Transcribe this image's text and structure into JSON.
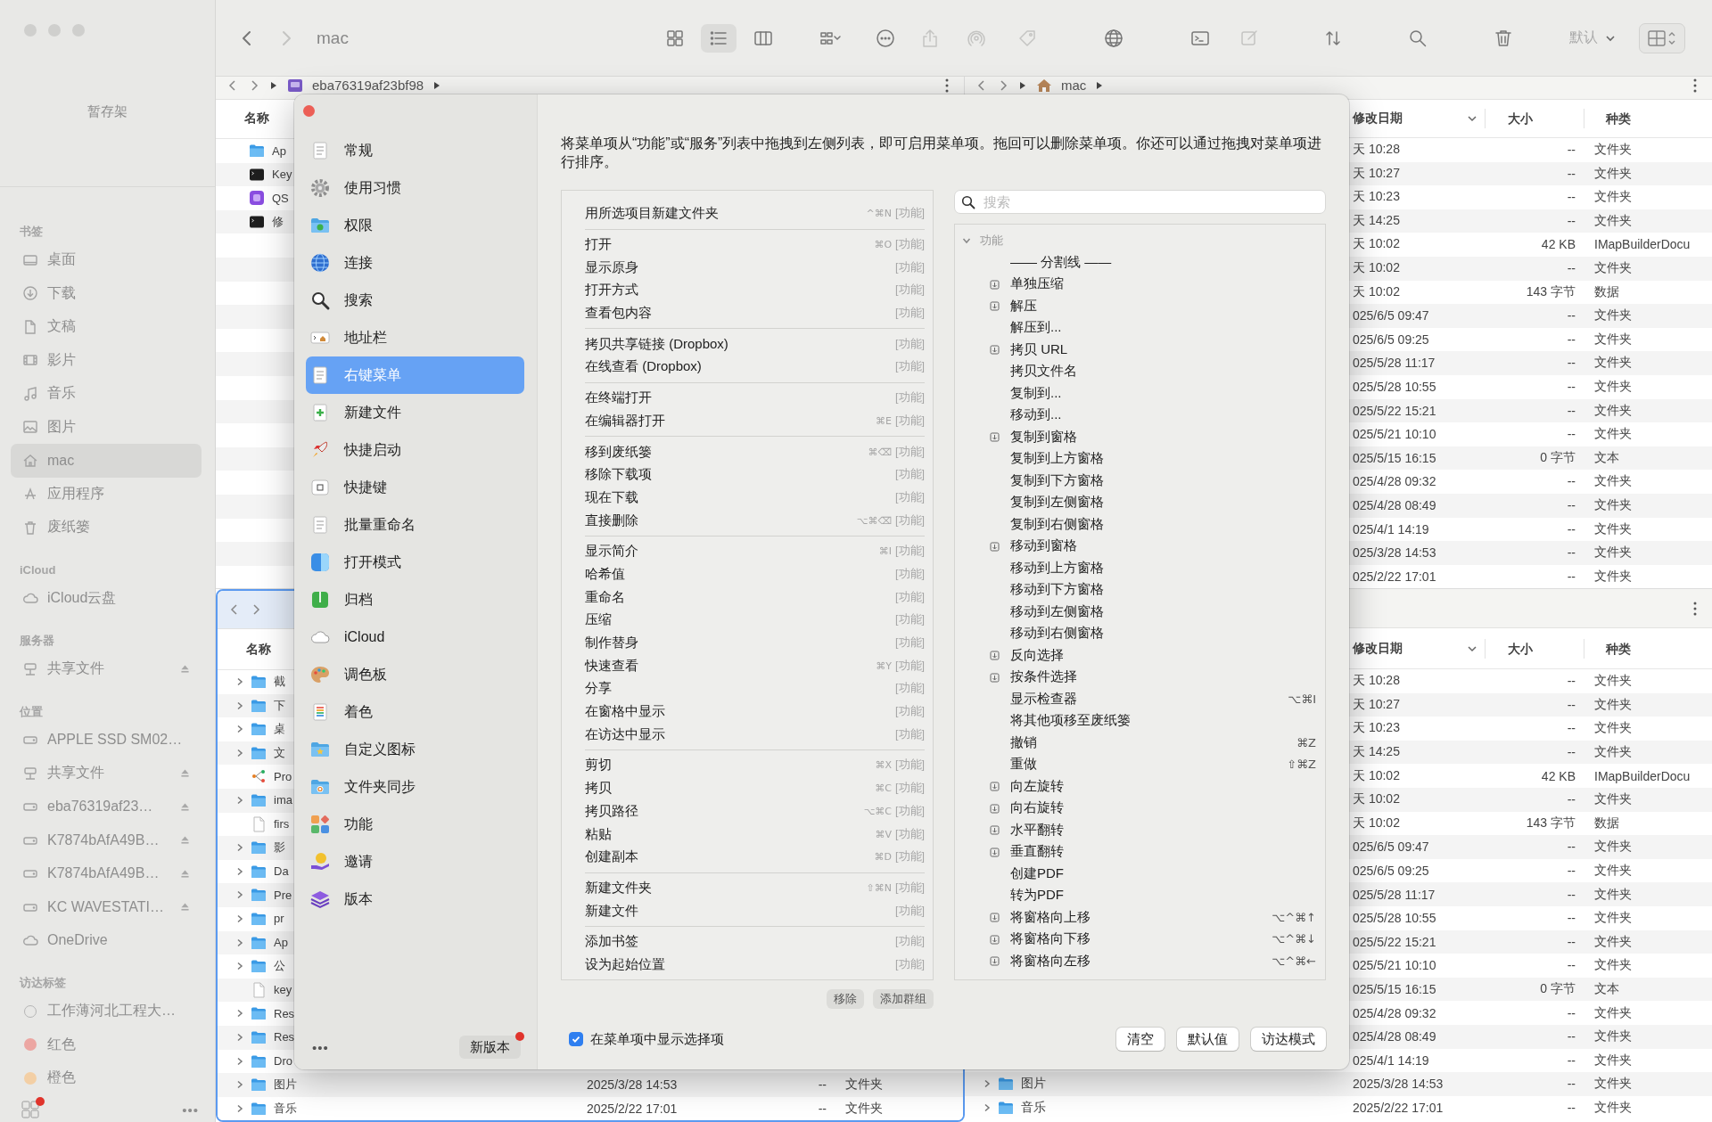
{
  "sidebar": {
    "shelf": "暂存架",
    "sections": [
      {
        "title": "书签",
        "items": [
          {
            "label": "桌面",
            "kind": "desktop",
            "selected": false,
            "ejectable": false
          },
          {
            "label": "下载",
            "kind": "download",
            "selected": false,
            "ejectable": false
          },
          {
            "label": "文稿",
            "kind": "document",
            "selected": false,
            "ejectable": false
          },
          {
            "label": "影片",
            "kind": "movie",
            "selected": false,
            "ejectable": false
          },
          {
            "label": "音乐",
            "kind": "music",
            "selected": false,
            "ejectable": false
          },
          {
            "label": "图片",
            "kind": "picture",
            "selected": false,
            "ejectable": false
          },
          {
            "label": "mac",
            "kind": "home",
            "selected": true,
            "ejectable": false
          },
          {
            "label": "应用程序",
            "kind": "apps",
            "selected": false,
            "ejectable": false
          },
          {
            "label": "废纸篓",
            "kind": "trash",
            "selected": false,
            "ejectable": false
          }
        ]
      },
      {
        "title": "iCloud",
        "items": [
          {
            "label": "iCloud云盘",
            "kind": "cloud",
            "selected": false,
            "ejectable": false
          }
        ]
      },
      {
        "title": "服务器",
        "items": [
          {
            "label": "共享文件",
            "kind": "server",
            "selected": false,
            "ejectable": true
          }
        ]
      },
      {
        "title": "位置",
        "items": [
          {
            "label": "APPLE SSD SM02…",
            "kind": "disk",
            "selected": false,
            "ejectable": false
          },
          {
            "label": "共享文件",
            "kind": "server",
            "selected": false,
            "ejectable": true
          },
          {
            "label": "eba76319af23…",
            "kind": "disk",
            "selected": false,
            "ejectable": true
          },
          {
            "label": "K7874bAfA49B…",
            "kind": "disk",
            "selected": false,
            "ejectable": true
          },
          {
            "label": "K7874bAfA49B…",
            "kind": "disk",
            "selected": false,
            "ejectable": true
          },
          {
            "label": "KC WAVESTATI…",
            "kind": "disk",
            "selected": false,
            "ejectable": true
          },
          {
            "label": "OneDrive",
            "kind": "cloud",
            "selected": false,
            "ejectable": false
          }
        ]
      },
      {
        "title": "访达标签",
        "items": [
          {
            "label": "工作薄河北工程大…",
            "kind": "tag",
            "selected": false,
            "ejectable": false
          },
          {
            "label": "红色",
            "kind": "tag",
            "color": "#eca6a2",
            "selected": false,
            "ejectable": false
          },
          {
            "label": "橙色",
            "kind": "tag",
            "color": "#f3cfa5",
            "selected": false,
            "ejectable": false
          }
        ]
      }
    ],
    "footer": {
      "badge": true,
      "more": "•••"
    }
  },
  "toolbar": {
    "nav": [
      {
        "kind": "back",
        "disabled": false
      },
      {
        "kind": "forward",
        "disabled": true
      }
    ],
    "title": "mac",
    "tools": [
      {
        "kind": "icons",
        "selected": false,
        "disabled": false
      },
      {
        "kind": "list",
        "selected": true,
        "disabled": false
      },
      {
        "kind": "columns",
        "selected": false,
        "disabled": false
      },
      {
        "kind": "group",
        "selected": false,
        "disabled": false
      },
      {
        "kind": "more",
        "selected": false,
        "disabled": false
      },
      {
        "kind": "share",
        "selected": false,
        "disabled": true
      },
      {
        "kind": "airdrop",
        "selected": false,
        "disabled": true
      },
      {
        "kind": "tag",
        "selected": false,
        "disabled": true
      },
      {
        "kind": "globe",
        "selected": false,
        "disabled": false
      },
      {
        "kind": "terminal",
        "selected": false,
        "disabled": false
      },
      {
        "kind": "edit",
        "selected": false,
        "disabled": true
      },
      {
        "kind": "sort",
        "selected": false,
        "disabled": false
      },
      {
        "kind": "search",
        "selected": false,
        "disabled": false
      },
      {
        "kind": "trash",
        "selected": false,
        "disabled": false
      }
    ],
    "sort_menu": "默认"
  },
  "panes": [
    {
      "focused": false,
      "nav": true,
      "menu": true,
      "path": {
        "kind": "disk",
        "label": "eba76319af23bf98"
      },
      "header": {
        "name": "名称"
      },
      "rows": [
        {
          "name": "Ap",
          "kind": "folder",
          "expandable": false
        },
        {
          "name": "Key",
          "kind": "terminal",
          "expandable": false
        },
        {
          "name": "QS",
          "kind": "app",
          "expandable": false
        },
        {
          "name": "修",
          "kind": "terminal",
          "expandable": false
        }
      ]
    },
    {
      "focused": false,
      "nav": true,
      "menu": true,
      "path": {
        "kind": "home",
        "label": "mac"
      },
      "header": {
        "date": "修改日期",
        "size": "大小",
        "type": "种类"
      },
      "rows": [
        {
          "date": "天 10:28",
          "size": "--",
          "type": "文件夹"
        },
        {
          "date": "天 10:27",
          "size": "--",
          "type": "文件夹"
        },
        {
          "date": "天 10:23",
          "size": "--",
          "type": "文件夹"
        },
        {
          "date": "天 14:25",
          "size": "--",
          "type": "文件夹"
        },
        {
          "date": "天 10:02",
          "size": "42 KB",
          "type": "IMapBuilderDocu"
        },
        {
          "date": "天 10:02",
          "size": "--",
          "type": "文件夹"
        },
        {
          "date": "天 10:02",
          "size": "143 字节",
          "type": "数据"
        },
        {
          "date": "025/6/5 09:47",
          "size": "--",
          "type": "文件夹"
        },
        {
          "date": "025/6/5 09:25",
          "size": "--",
          "type": "文件夹"
        },
        {
          "date": "025/5/28 11:17",
          "size": "--",
          "type": "文件夹"
        },
        {
          "date": "025/5/28 10:55",
          "size": "--",
          "type": "文件夹"
        },
        {
          "date": "025/5/22 15:21",
          "size": "--",
          "type": "文件夹"
        },
        {
          "date": "025/5/21 10:10",
          "size": "--",
          "type": "文件夹"
        },
        {
          "date": "025/5/15 16:15",
          "size": "0 字节",
          "type": "文本"
        },
        {
          "date": "025/4/28 09:32",
          "size": "--",
          "type": "文件夹"
        },
        {
          "date": "025/4/28 08:49",
          "size": "--",
          "type": "文件夹"
        },
        {
          "date": "025/4/1 14:19",
          "size": "--",
          "type": "文件夹"
        },
        {
          "date": "025/3/28 14:53",
          "size": "--",
          "type": "文件夹"
        },
        {
          "date": "025/2/22 17:01",
          "size": "--",
          "type": "文件夹"
        }
      ]
    },
    {
      "focused": true,
      "nav": true,
      "menu": false,
      "header": {
        "name": "名称"
      },
      "rows": [
        {
          "name": "截",
          "kind": "folder",
          "expandable": true
        },
        {
          "name": "下",
          "kind": "folder",
          "expandable": true
        },
        {
          "name": "桌",
          "kind": "folder",
          "expandable": true
        },
        {
          "name": "文",
          "kind": "folder",
          "expandable": true
        },
        {
          "name": "Pro",
          "kind": "diagram",
          "expandable": false
        },
        {
          "name": "ima",
          "kind": "folder",
          "expandable": true
        },
        {
          "name": "firs",
          "kind": "file",
          "expandable": false
        },
        {
          "name": "影",
          "kind": "folder",
          "expandable": true
        },
        {
          "name": "Da",
          "kind": "folder",
          "expandable": true
        },
        {
          "name": "Pre",
          "kind": "folder",
          "expandable": true
        },
        {
          "name": "pr",
          "kind": "folder",
          "expandable": true
        },
        {
          "name": "Ap",
          "kind": "folder",
          "expandable": true
        },
        {
          "name": "公",
          "kind": "folder",
          "expandable": true
        },
        {
          "name": "key",
          "kind": "file",
          "expandable": false
        },
        {
          "name": "Res",
          "kind": "folder",
          "expandable": true
        },
        {
          "name": "Res",
          "kind": "folder",
          "expandable": true
        },
        {
          "name": "Dro",
          "kind": "folder",
          "expandable": true
        },
        {
          "name": "图片",
          "kind": "folder",
          "expandable": true,
          "date": "2025/3/28 14:53",
          "size": "--",
          "type": "文件夹"
        },
        {
          "name": "音乐",
          "kind": "folder",
          "expandable": true,
          "date": "2025/2/22 17:01",
          "size": "--",
          "type": "文件夹"
        }
      ]
    },
    {
      "focused": false,
      "nav": false,
      "menu": true,
      "header": {
        "date": "修改日期",
        "size": "大小",
        "type": "种类"
      },
      "rows": [
        {
          "date": "天 10:28",
          "size": "--",
          "type": "文件夹"
        },
        {
          "date": "天 10:27",
          "size": "--",
          "type": "文件夹"
        },
        {
          "date": "天 10:23",
          "size": "--",
          "type": "文件夹"
        },
        {
          "date": "天 14:25",
          "size": "--",
          "type": "文件夹"
        },
        {
          "date": "天 10:02",
          "size": "42 KB",
          "type": "IMapBuilderDocu"
        },
        {
          "date": "天 10:02",
          "size": "--",
          "type": "文件夹"
        },
        {
          "date": "天 10:02",
          "size": "143 字节",
          "type": "数据"
        },
        {
          "date": "025/6/5 09:47",
          "size": "--",
          "type": "文件夹"
        },
        {
          "date": "025/6/5 09:25",
          "size": "--",
          "type": "文件夹"
        },
        {
          "date": "025/5/28 11:17",
          "size": "--",
          "type": "文件夹"
        },
        {
          "date": "025/5/28 10:55",
          "size": "--",
          "type": "文件夹"
        },
        {
          "date": "025/5/22 15:21",
          "size": "--",
          "type": "文件夹"
        },
        {
          "date": "025/5/21 10:10",
          "size": "--",
          "type": "文件夹"
        },
        {
          "date": "025/5/15 16:15",
          "size": "0 字节",
          "type": "文本"
        },
        {
          "date": "025/4/28 09:32",
          "size": "--",
          "type": "文件夹"
        },
        {
          "date": "025/4/28 08:49",
          "size": "--",
          "type": "文件夹"
        },
        {
          "date": "025/4/1 14:19",
          "size": "--",
          "type": "文件夹"
        },
        {
          "name": "图片",
          "kind": "folder",
          "expandable": true,
          "date": "2025/3/28 14:53",
          "size": "--",
          "type": "文件夹"
        },
        {
          "name": "音乐",
          "kind": "folder",
          "expandable": true,
          "date": "2025/2/22 17:01",
          "size": "--",
          "type": "文件夹"
        }
      ]
    }
  ],
  "dialog": {
    "nav": [
      {
        "label": "常规",
        "kind": "page",
        "selected": false
      },
      {
        "label": "使用习惯",
        "kind": "gear",
        "selected": false
      },
      {
        "label": "权限",
        "kind": "folder-check",
        "selected": false
      },
      {
        "label": "连接",
        "kind": "globe",
        "selected": false
      },
      {
        "label": "搜索",
        "kind": "search",
        "selected": false
      },
      {
        "label": "地址栏",
        "kind": "address",
        "selected": false
      },
      {
        "label": "右键菜单",
        "kind": "page",
        "selected": true
      },
      {
        "label": "新建文件",
        "kind": "newfile",
        "selected": false
      },
      {
        "label": "快捷启动",
        "kind": "rocket",
        "selected": false
      },
      {
        "label": "快捷键",
        "kind": "key",
        "selected": false
      },
      {
        "label": "批量重命名",
        "kind": "page",
        "selected": false
      },
      {
        "label": "打开模式",
        "kind": "finder",
        "selected": false
      },
      {
        "label": "归档",
        "kind": "archive",
        "selected": false
      },
      {
        "label": "iCloud",
        "kind": "cloud",
        "selected": false
      },
      {
        "label": "调色板",
        "kind": "palette",
        "selected": false
      },
      {
        "label": "着色",
        "kind": "colorlist",
        "selected": false
      },
      {
        "label": "自定义图标",
        "kind": "folder-star",
        "selected": false
      },
      {
        "label": "文件夹同步",
        "kind": "folder-sync",
        "selected": false
      },
      {
        "label": "功能",
        "kind": "tiles",
        "selected": false
      },
      {
        "label": "邀请",
        "kind": "coin",
        "selected": false
      },
      {
        "label": "版本",
        "kind": "layers",
        "selected": false
      }
    ],
    "more": "•••",
    "update": {
      "label": "新版本",
      "badge": true
    },
    "description": "将菜单项从“功能”或“服务”列表中拖拽到左侧列表，即可启用菜单项。拖回可以删除菜单项。你还可以通过拖拽对菜单项进行排序。",
    "menu_groups": [
      {
        "items": [
          {
            "label": "用所选项目新建文件夹",
            "shortcut": "^⌘N",
            "source": "[功能]"
          }
        ]
      },
      {
        "items": [
          {
            "label": "打开",
            "shortcut": "⌘O",
            "source": "[功能]"
          },
          {
            "label": "显示原身",
            "source": "[功能]"
          },
          {
            "label": "打开方式",
            "source": "[功能]"
          },
          {
            "label": "查看包内容",
            "source": "[功能]"
          }
        ]
      },
      {
        "items": [
          {
            "label": "拷贝共享链接 (Dropbox)",
            "source": "[功能]"
          },
          {
            "label": "在线查看 (Dropbox)",
            "source": "[功能]"
          }
        ]
      },
      {
        "items": [
          {
            "label": "在终端打开",
            "source": "[功能]"
          },
          {
            "label": "在编辑器打开",
            "shortcut": "⌘E",
            "source": "[功能]"
          }
        ]
      },
      {
        "items": [
          {
            "label": "移到废纸篓",
            "shortcut": "⌘⌫",
            "source": "[功能]"
          },
          {
            "label": "移除下载项",
            "source": "[功能]"
          },
          {
            "label": "现在下载",
            "source": "[功能]"
          },
          {
            "label": "直接删除",
            "shortcut": "⌥⌘⌫",
            "source": "[功能]"
          }
        ]
      },
      {
        "items": [
          {
            "label": "显示简介",
            "shortcut": "⌘I",
            "source": "[功能]"
          },
          {
            "label": "哈希值",
            "source": "[功能]"
          },
          {
            "label": "重命名",
            "source": "[功能]"
          },
          {
            "label": "压缩",
            "source": "[功能]"
          },
          {
            "label": "制作替身",
            "source": "[功能]"
          },
          {
            "label": "快速查看",
            "shortcut": "⌘Y",
            "source": "[功能]"
          },
          {
            "label": "分享",
            "source": "[功能]"
          },
          {
            "label": "在窗格中显示",
            "source": "[功能]"
          },
          {
            "label": "在访达中显示",
            "source": "[功能]"
          }
        ]
      },
      {
        "items": [
          {
            "label": "剪切",
            "shortcut": "⌘X",
            "source": "[功能]"
          },
          {
            "label": "拷贝",
            "shortcut": "⌘C",
            "source": "[功能]"
          },
          {
            "label": "拷贝路径",
            "shortcut": "⌥⌘C",
            "source": "[功能]"
          },
          {
            "label": "粘贴",
            "shortcut": "⌘V",
            "source": "[功能]"
          },
          {
            "label": "创建副本",
            "shortcut": "⌘D",
            "source": "[功能]"
          }
        ]
      },
      {
        "items": [
          {
            "label": "新建文件夹",
            "shortcut": "⇧⌘N",
            "source": "[功能]"
          },
          {
            "label": "新建文件",
            "source": "[功能]"
          }
        ]
      },
      {
        "items": [
          {
            "label": "添加书签",
            "source": "[功能]"
          },
          {
            "label": "设为起始位置",
            "source": "[功能]"
          }
        ]
      }
    ],
    "list_buttons": [
      "移除",
      "添加群组"
    ],
    "show_selection": {
      "label": "在菜单项中显示选择项",
      "checked": true
    },
    "search": {
      "placeholder": "搜索"
    },
    "library": {
      "title": "功能",
      "expanded": true,
      "children": [
        {
          "label": "—— 分割线 ——",
          "icon": false
        },
        {
          "label": "单独压缩",
          "icon": true
        },
        {
          "label": "解压",
          "icon": true
        },
        {
          "label": "解压到...",
          "icon": false
        },
        {
          "label": "拷贝 URL",
          "icon": true
        },
        {
          "label": "拷贝文件名",
          "icon": false
        },
        {
          "label": "复制到...",
          "icon": false
        },
        {
          "label": "移动到...",
          "icon": false
        },
        {
          "label": "复制到窗格",
          "icon": true
        },
        {
          "label": "复制到上方窗格",
          "icon": false
        },
        {
          "label": "复制到下方窗格",
          "icon": false
        },
        {
          "label": "复制到左侧窗格",
          "icon": false
        },
        {
          "label": "复制到右侧窗格",
          "icon": false
        },
        {
          "label": "移动到窗格",
          "icon": true
        },
        {
          "label": "移动到上方窗格",
          "icon": false
        },
        {
          "label": "移动到下方窗格",
          "icon": false
        },
        {
          "label": "移动到左侧窗格",
          "icon": false
        },
        {
          "label": "移动到右侧窗格",
          "icon": false
        },
        {
          "label": "反向选择",
          "icon": true
        },
        {
          "label": "按条件选择",
          "icon": true
        },
        {
          "label": "显示检查器",
          "icon": false,
          "shortcut": "⌥⌘I"
        },
        {
          "label": "将其他项移至废纸篓",
          "icon": false
        },
        {
          "label": "撤销",
          "icon": false,
          "shortcut": "⌘Z"
        },
        {
          "label": "重做",
          "icon": false,
          "shortcut": "⇧⌘Z"
        },
        {
          "label": "向左旋转",
          "icon": true
        },
        {
          "label": "向右旋转",
          "icon": true
        },
        {
          "label": "水平翻转",
          "icon": true
        },
        {
          "label": "垂直翻转",
          "icon": true
        },
        {
          "label": "创建PDF",
          "icon": false
        },
        {
          "label": "转为PDF",
          "icon": false
        },
        {
          "label": "将窗格向上移",
          "icon": true,
          "shortcut": "⌥^⌘↑"
        },
        {
          "label": "将窗格向下移",
          "icon": true,
          "shortcut": "⌥^⌘↓"
        },
        {
          "label": "将窗格向左移",
          "icon": true,
          "shortcut": "⌥^⌘←"
        }
      ]
    },
    "buttons": [
      "清空",
      "默认值",
      "访达模式"
    ]
  }
}
